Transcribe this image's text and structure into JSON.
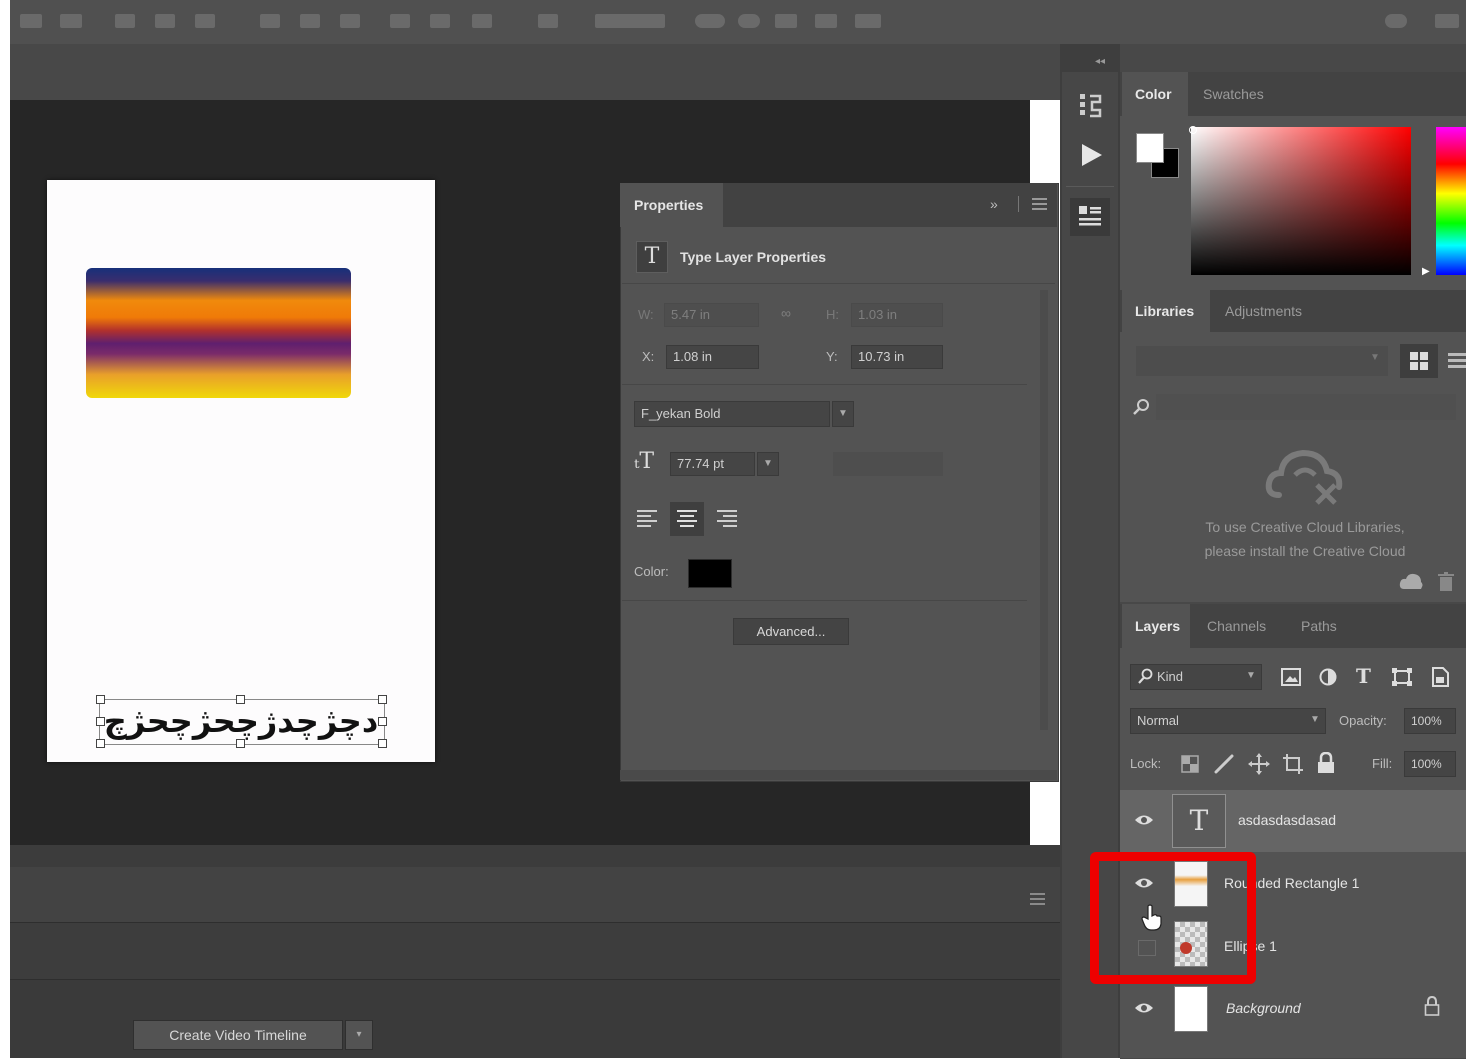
{
  "properties_panel": {
    "tab": "Properties",
    "section_title": "Type Layer Properties",
    "width_label": "W:",
    "width_value": "5.47 in",
    "height_label": "H:",
    "height_value": "1.03 in",
    "x_label": "X:",
    "x_value": "1.08 in",
    "y_label": "Y:",
    "y_value": "10.73 in",
    "font_family": "F_yekan Bold",
    "font_size": "77.74 pt",
    "color_label": "Color:",
    "color_value": "#000000",
    "advanced_button": "Advanced..."
  },
  "color_panel": {
    "tabs": [
      "Color",
      "Swatches"
    ],
    "active_tab": "Color"
  },
  "libraries_panel": {
    "tabs": [
      "Libraries",
      "Adjustments"
    ],
    "active_tab": "Libraries",
    "message_line1": "To use Creative Cloud Libraries,",
    "message_line2": "please install the Creative Cloud"
  },
  "layers_panel": {
    "tabs": [
      "Layers",
      "Channels",
      "Paths"
    ],
    "active_tab": "Layers",
    "filter_kind": "Kind",
    "blend_mode": "Normal",
    "opacity_label": "Opacity:",
    "opacity_value": "100%",
    "lock_label": "Lock:",
    "fill_label": "Fill:",
    "fill_value": "100%",
    "layers": [
      {
        "name": "asdasdasdasad",
        "visible": true,
        "selected": true
      },
      {
        "name": "Rounded Rectangle 1",
        "visible": true,
        "selected": false
      },
      {
        "name": "Ellipse 1",
        "visible": false,
        "selected": false
      },
      {
        "name": "Background",
        "visible": true,
        "selected": false
      }
    ]
  },
  "canvas": {
    "text_layer_content": "دچژچدژچحژچحژچ"
  },
  "timeline": {
    "create_button": "Create Video Timeline"
  },
  "colors": {
    "highlight": "#ee0000",
    "panel_bg": "#535353",
    "canvas_bg": "#262626"
  }
}
